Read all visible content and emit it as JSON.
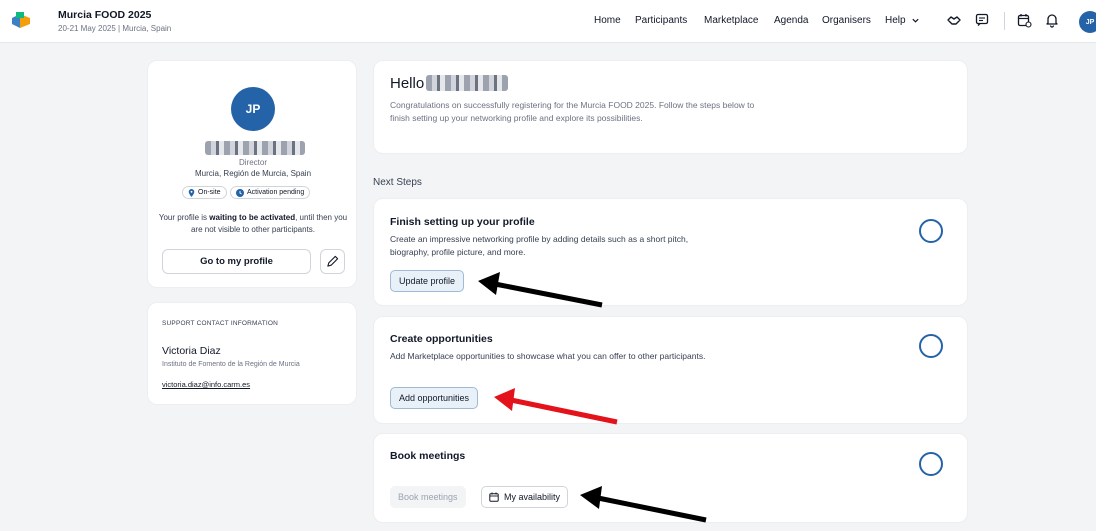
{
  "header": {
    "event_title": "Murcia FOOD 2025",
    "event_subtitle": "20-21 May 2025 | Murcia, Spain",
    "nav": [
      "Home",
      "Participants",
      "Marketplace",
      "Agenda",
      "Organisers",
      "Help"
    ],
    "avatar_initials": "JP",
    "icons": [
      "handshake-icon",
      "chat-icon",
      "calendar-icon",
      "bell-icon"
    ]
  },
  "profile": {
    "initials": "JP",
    "role": "Director",
    "location": "Murcia, Región de Murcia, Spain",
    "badge_onsite": "On-site",
    "badge_status": "Activation pending",
    "waiting_pre": "Your profile is ",
    "waiting_bold": "waiting to be activated",
    "waiting_post": ", until then you are not visible to other participants.",
    "goto_label": "Go to my profile"
  },
  "support": {
    "heading": "SUPPORT CONTACT INFORMATION",
    "name": "Victoria Diaz",
    "org": "Instituto de Fomento de la Región de Murcia",
    "email": "victoria.diaz@info.carm.es"
  },
  "hello": {
    "title": "Hello",
    "text": "Congratulations on successfully registering for the Murcia FOOD 2025. Follow the steps below to finish setting up your networking profile and explore its possibilities."
  },
  "next_steps_label": "Next Steps",
  "steps": {
    "profile": {
      "title": "Finish setting up your profile",
      "desc": "Create an impressive networking profile by adding details such as a short pitch, biography, profile picture, and more.",
      "button": "Update profile"
    },
    "opportunities": {
      "title": "Create opportunities",
      "desc": "Add Marketplace opportunities to showcase what you can offer to other participants.",
      "button": "Add opportunities"
    },
    "meetings": {
      "title": "Book meetings",
      "button_disabled": "Book meetings",
      "button_availability": "My availability"
    }
  },
  "colors": {
    "accent": "#2563a8",
    "arrow_black": "#000000",
    "arrow_red": "#e3121b"
  }
}
